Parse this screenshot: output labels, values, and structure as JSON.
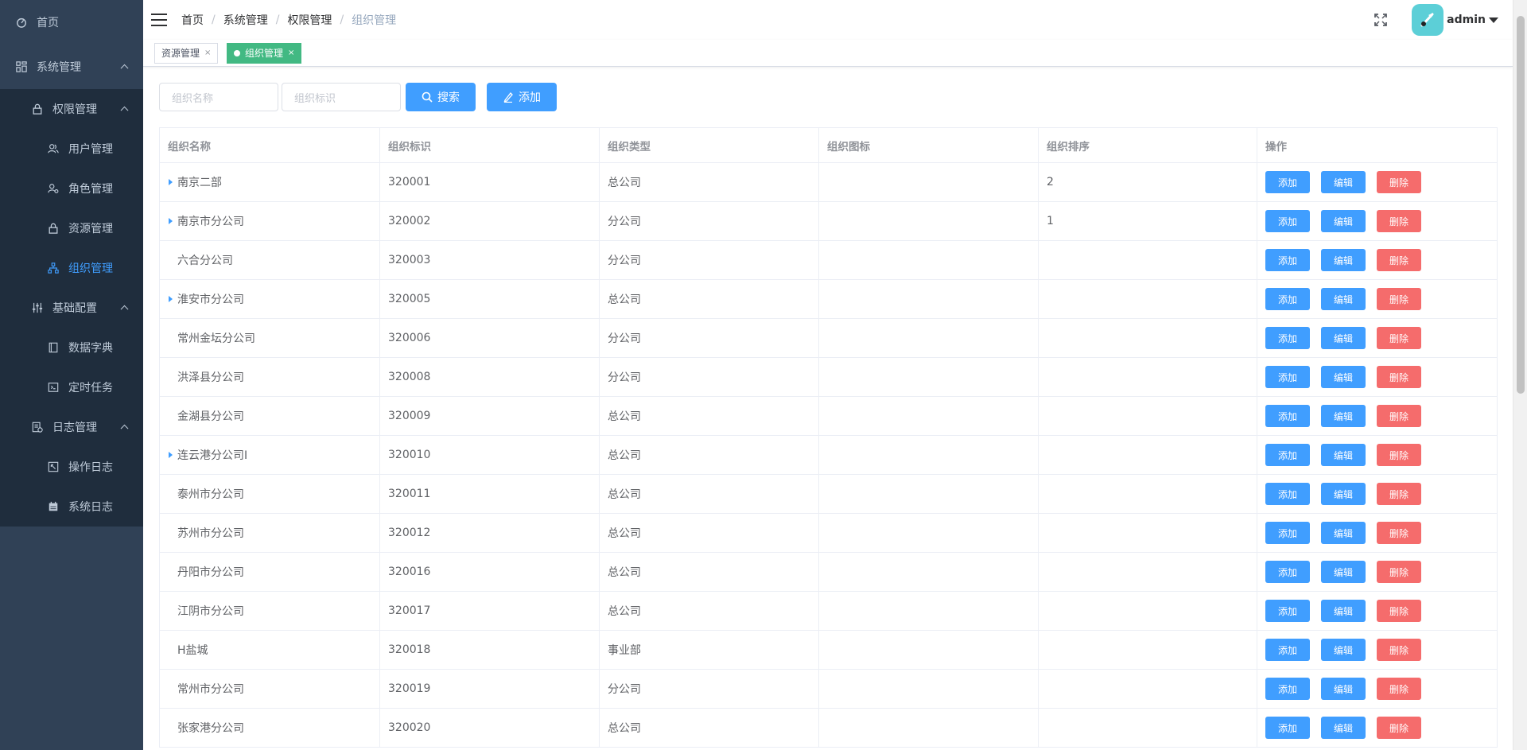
{
  "sidebar": {
    "home": "首页",
    "system": "系统管理",
    "permission": "权限管理",
    "user": "用户管理",
    "role": "角色管理",
    "resource": "资源管理",
    "org": "组织管理",
    "basic": "基础配置",
    "dict": "数据字典",
    "timer": "定时任务",
    "log": "日志管理",
    "oplog": "操作日志",
    "syslog": "系统日志"
  },
  "breadcrumb": [
    "首页",
    "系统管理",
    "权限管理",
    "组织管理"
  ],
  "user": {
    "name": "admin"
  },
  "tags": [
    {
      "label": "资源管理",
      "close": "×"
    },
    {
      "label": "组织管理",
      "close": "×"
    }
  ],
  "filter": {
    "name_placeholder": "组织名称",
    "code_placeholder": "组织标识",
    "search_label": "搜索",
    "add_label": "添加"
  },
  "table": {
    "headers": [
      "组织名称",
      "组织标识",
      "组织类型",
      "组织图标",
      "组织排序",
      "操作"
    ],
    "actions": {
      "add": "添加",
      "edit": "编辑",
      "delete": "删除"
    },
    "rows": [
      {
        "name": "南京二部",
        "code": "320001",
        "type": "总公司",
        "icon": "",
        "sort": "2",
        "expandable": true
      },
      {
        "name": "南京市分公司",
        "code": "320002",
        "type": "分公司",
        "icon": "",
        "sort": "1",
        "expandable": true
      },
      {
        "name": "六合分公司",
        "code": "320003",
        "type": "分公司",
        "icon": "",
        "sort": "",
        "expandable": false
      },
      {
        "name": "淮安市分公司",
        "code": "320005",
        "type": "总公司",
        "icon": "",
        "sort": "",
        "expandable": true
      },
      {
        "name": "常州金坛分公司",
        "code": "320006",
        "type": "分公司",
        "icon": "",
        "sort": "",
        "expandable": false
      },
      {
        "name": "洪泽县分公司",
        "code": "320008",
        "type": "分公司",
        "icon": "",
        "sort": "",
        "expandable": false
      },
      {
        "name": "金湖县分公司",
        "code": "320009",
        "type": "总公司",
        "icon": "",
        "sort": "",
        "expandable": false
      },
      {
        "name": "连云港分公司Ⅰ",
        "code": "320010",
        "type": "总公司",
        "icon": "",
        "sort": "",
        "expandable": true
      },
      {
        "name": "泰州市分公司",
        "code": "320011",
        "type": "总公司",
        "icon": "",
        "sort": "",
        "expandable": false
      },
      {
        "name": "苏州市分公司",
        "code": "320012",
        "type": "总公司",
        "icon": "",
        "sort": "",
        "expandable": false
      },
      {
        "name": "丹阳市分公司",
        "code": "320016",
        "type": "总公司",
        "icon": "",
        "sort": "",
        "expandable": false
      },
      {
        "name": "江阴市分公司",
        "code": "320017",
        "type": "总公司",
        "icon": "",
        "sort": "",
        "expandable": false
      },
      {
        "name": "H盐城",
        "code": "320018",
        "type": "事业部",
        "icon": "",
        "sort": "",
        "expandable": false
      },
      {
        "name": "常州市分公司",
        "code": "320019",
        "type": "分公司",
        "icon": "",
        "sort": "",
        "expandable": false
      },
      {
        "name": "张家港分公司",
        "code": "320020",
        "type": "总公司",
        "icon": "",
        "sort": "",
        "expandable": false
      }
    ]
  }
}
